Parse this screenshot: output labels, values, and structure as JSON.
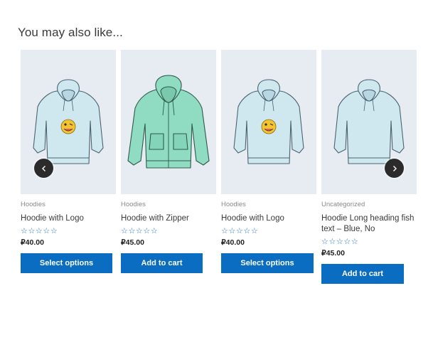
{
  "section": {
    "heading": "You may also like..."
  },
  "carousel": {
    "prev_icon": "chevron-left-icon",
    "next_icon": "chevron-right-icon",
    "products": [
      {
        "category": "Hoodies",
        "title": "Hoodie with Logo",
        "rating_stars": "☆☆☆☆☆",
        "price": "₽40.00",
        "button": "Select options",
        "image": "hoodie-with-logo",
        "color": "#cfe8f0"
      },
      {
        "category": "Hoodies",
        "title": "Hoodie with Zipper",
        "rating_stars": "☆☆☆☆☆",
        "price": "₽45.00",
        "button": "Add to cart",
        "image": "hoodie-with-zipper",
        "color": "#8fdcc2"
      },
      {
        "category": "Hoodies",
        "title": "Hoodie with Logo",
        "rating_stars": "☆☆☆☆☆",
        "price": "₽40.00",
        "button": "Select options",
        "image": "hoodie-with-logo",
        "color": "#cfe8f0"
      },
      {
        "category": "Uncategorized",
        "title": "Hoodie Long heading fish text – Blue, No",
        "rating_stars": "☆☆☆☆☆",
        "price": "₽45.00",
        "button": "Add to cart",
        "image": "plain-blue-hoodie",
        "color": "#cfe8f0"
      }
    ]
  },
  "colors": {
    "button": "#0a6dc2",
    "rating": "#1e73be",
    "image_background": "#e6ecf1"
  }
}
